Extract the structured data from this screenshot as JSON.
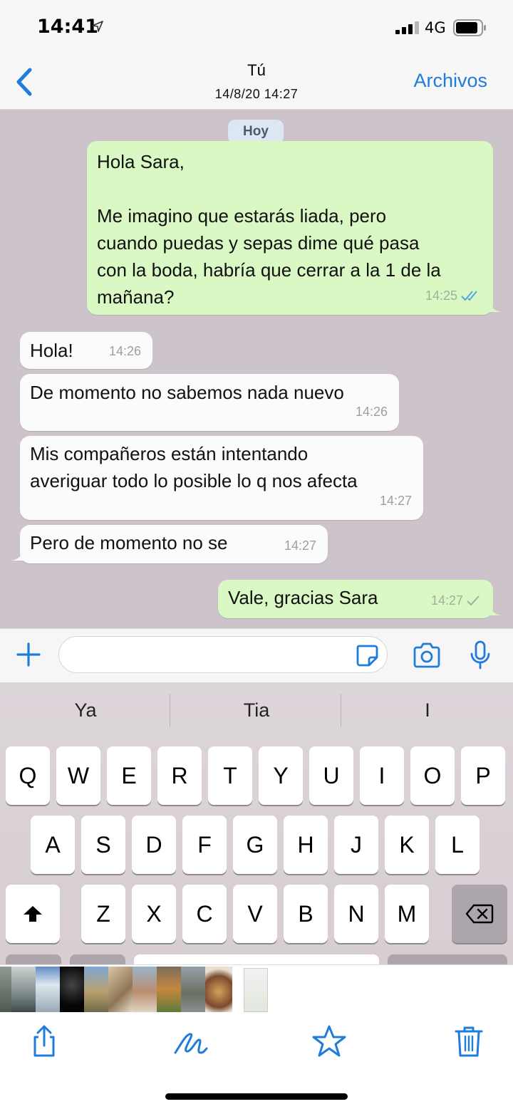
{
  "status_bar": {
    "time": "14:41",
    "network": "4G"
  },
  "header": {
    "title": "Tú",
    "subtitle": "14/8/20 14:27",
    "action_label": "Archivos"
  },
  "chat": {
    "day_label": "Hoy",
    "messages": [
      {
        "direction": "out",
        "text": "Hola Sara,\n\nMe imagino que estarás liada, pero\ncuando puedas y sepas dime qué pasa\ncon la boda, habría que cerrar a la 1 de la\nmañana?",
        "time": "14:25",
        "status": "read"
      },
      {
        "direction": "in",
        "text": "Hola!",
        "time": "14:26"
      },
      {
        "direction": "in",
        "text": "De momento no sabemos nada nuevo",
        "time": "14:26"
      },
      {
        "direction": "in",
        "text": "Mis compañeros están intentando\naveriguar todo lo posible lo q nos afecta",
        "time": "14:27"
      },
      {
        "direction": "in",
        "text": "Pero de momento no se",
        "time": "14:27"
      },
      {
        "direction": "out",
        "text": "Vale, gracias Sara",
        "time": "14:27",
        "status": "sent"
      }
    ]
  },
  "input_bar": {
    "message_value": "",
    "message_placeholder": ""
  },
  "keyboard": {
    "suggestions": [
      "Ya",
      "Tia",
      "I"
    ],
    "row1": [
      "Q",
      "W",
      "E",
      "R",
      "T",
      "Y",
      "U",
      "I",
      "O",
      "P"
    ],
    "row2": [
      "A",
      "S",
      "D",
      "F",
      "G",
      "H",
      "J",
      "K",
      "L"
    ],
    "row3": [
      "Z",
      "X",
      "C",
      "V",
      "B",
      "N",
      "M"
    ]
  },
  "colors": {
    "accent": "#1f7bdc",
    "outgoing_bubble": "#d9f8c4",
    "incoming_bubble": "#fbfbfb",
    "chat_background": "#cdc4cb",
    "read_tick": "#4fa8e8"
  },
  "icons": {
    "status": [
      "location-arrow-icon",
      "signal-icon",
      "battery-icon"
    ],
    "header": [
      "chevron-left-icon"
    ],
    "input": [
      "plus-icon",
      "sticker-icon",
      "camera-icon",
      "microphone-icon"
    ],
    "keyboard": [
      "shift-icon",
      "delete-icon"
    ],
    "toolbar": [
      "share-icon",
      "markup-icon",
      "favorite-star-icon",
      "trash-icon"
    ]
  }
}
